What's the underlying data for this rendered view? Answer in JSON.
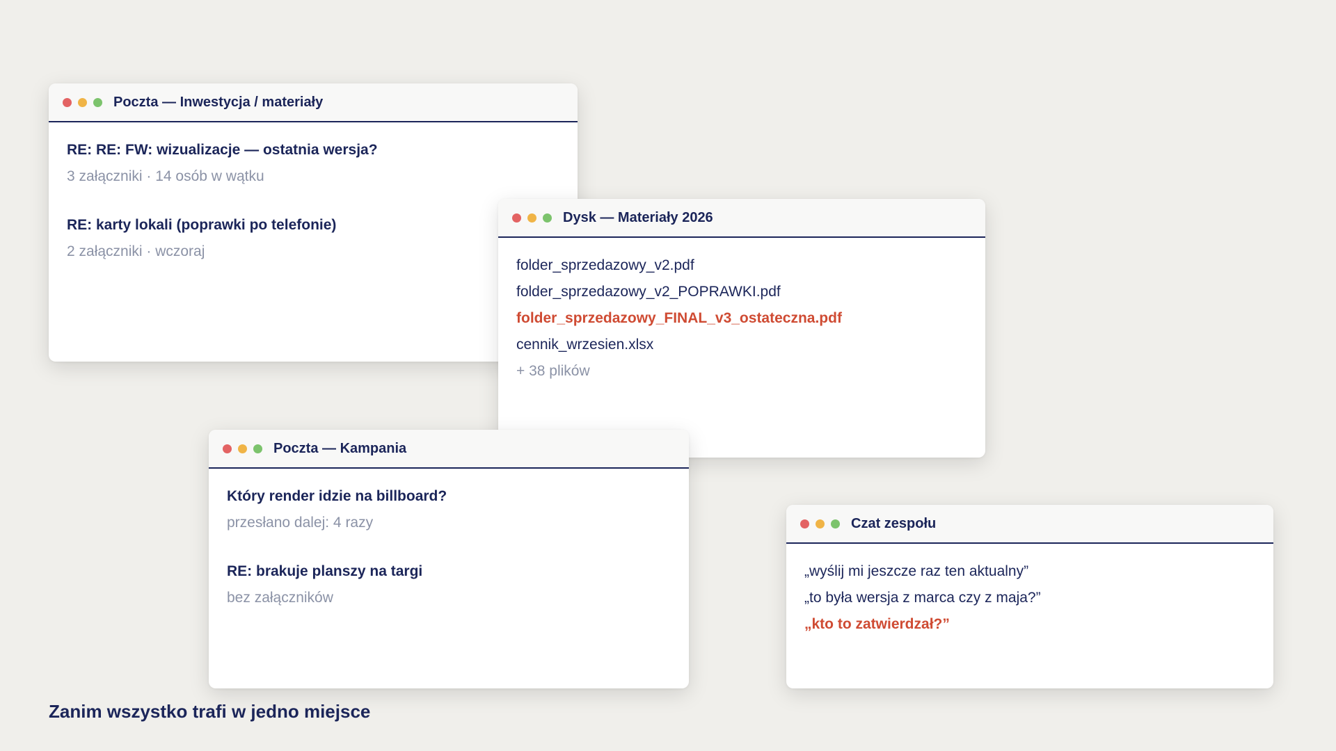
{
  "windows": {
    "mail_investment": {
      "title": "Poczta — Inwestycja / materiały",
      "items": [
        {
          "subject": "RE: RE: FW: wizualizacje — ostatnia wersja?",
          "meta": "3 załączniki · 14 osób w wątku"
        },
        {
          "subject": "RE: karty lokali (poprawki po telefonie)",
          "meta": "2 załączniki · wczoraj"
        }
      ]
    },
    "drive": {
      "title": "Dysk — Materiały 2026",
      "files": [
        "folder_sprzedazowy_v2.pdf",
        "folder_sprzedazowy_v2_POPRAWKI.pdf",
        "folder_sprzedazowy_FINAL_v3_ostateczna.pdf",
        "cennik_wrzesien.xlsx"
      ],
      "more": "+ 38 plików"
    },
    "mail_campaign": {
      "title": "Poczta — Kampania",
      "items": [
        {
          "subject": "Który render idzie na billboard?",
          "meta": "przesłano dalej: 4 razy"
        },
        {
          "subject": "RE: brakuje planszy na targi",
          "meta": "bez załączników"
        }
      ]
    },
    "chat": {
      "title": "Czat zespołu",
      "lines": [
        "„wyślij mi jeszcze raz ten aktualny”",
        "„to była wersja z marca czy z maja?”",
        "„kto to zatwierdzał?”"
      ]
    }
  },
  "caption": "Zanim wszystko trafi w jedno miejsce",
  "colors": {
    "background": "#f0efeb",
    "text_primary": "#1b2559",
    "text_muted": "#8b92a6",
    "highlight": "#cf4b33",
    "dot_red": "#e36363",
    "dot_yellow": "#f0b446",
    "dot_green": "#7cc36c"
  }
}
